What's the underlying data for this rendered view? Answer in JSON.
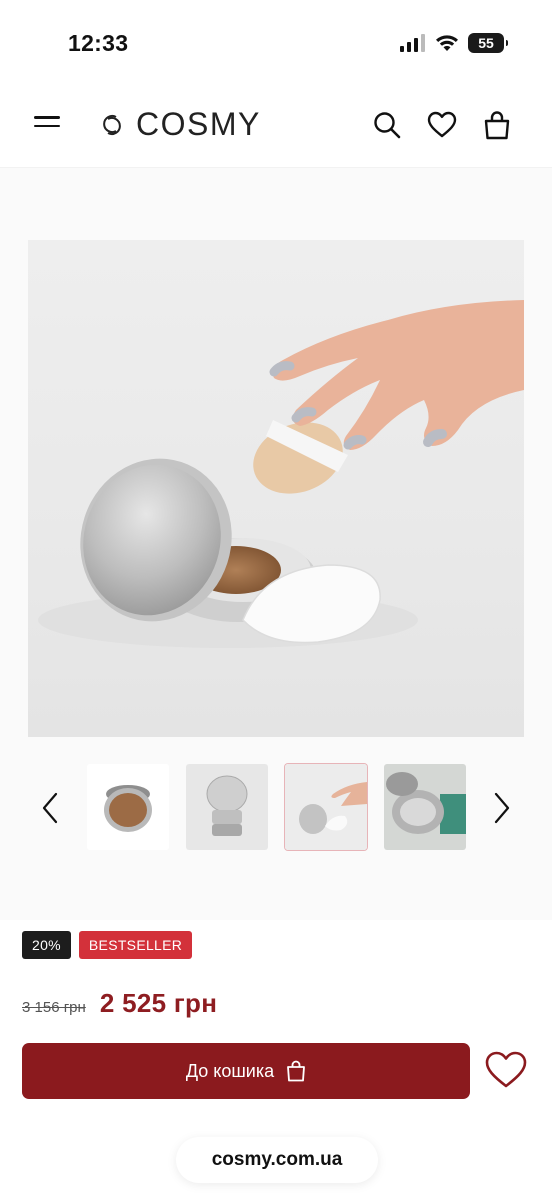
{
  "status_bar": {
    "time": "12:33",
    "battery": "55"
  },
  "header": {
    "logo_text": "COSMY"
  },
  "product": {
    "badges": {
      "discount": "20%",
      "bestseller": "BESTSELLER"
    },
    "old_price": "3 156 грн",
    "new_price": "2 525 грн"
  },
  "actions": {
    "add_to_cart": "До кошика"
  },
  "browser": {
    "url": "cosmy.com.ua"
  },
  "colors": {
    "accent": "#8b1a1e",
    "badge_red": "#d3313a",
    "price": "#8e1d21"
  },
  "icons": [
    "menu-icon",
    "logo-icon",
    "search-icon",
    "heart-icon",
    "bag-icon",
    "chevron-left-icon",
    "chevron-right-icon"
  ],
  "gallery": {
    "thumbnail_count": 4,
    "active_index": 2
  }
}
